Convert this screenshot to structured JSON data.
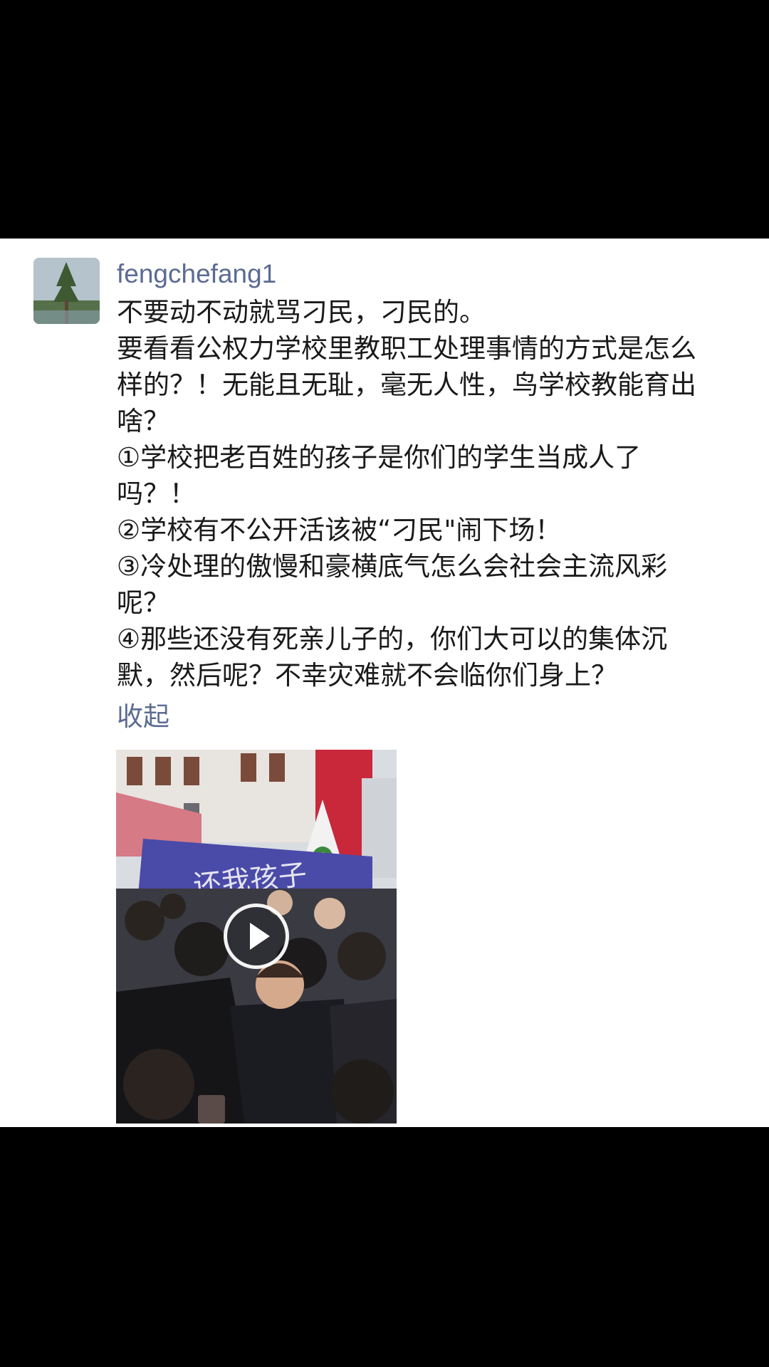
{
  "post": {
    "username": "fengchefang1",
    "lines": [
      "不要动不动就骂刁民，刁民的。",
      "要看看公权力学校里教职工处理事情的方式是怎么",
      "样的？！无能且无耻，毫无人性，鸟学校教能育出",
      "啥？",
      "①学校把老百姓的孩子是你们的学生当成人了",
      "吗？！",
      "②学校有不公开活该被“刁民\"闹下场！",
      "③冷处理的傲慢和豪横底气怎么会社会主流风彩",
      "呢？",
      "④那些还没有死亲儿子的，你们大可以的集体沉",
      "默，然后呢？不幸灾难就不会临你们身上？"
    ],
    "collapse_label": "收起",
    "video": {
      "play_icon": "play-icon",
      "banner_text": "还我孩子"
    }
  },
  "colors": {
    "background": "#000000",
    "card": "#ffffff",
    "username": "#5b6b93",
    "link": "#5b6b93",
    "text": "#1a1a1a"
  }
}
